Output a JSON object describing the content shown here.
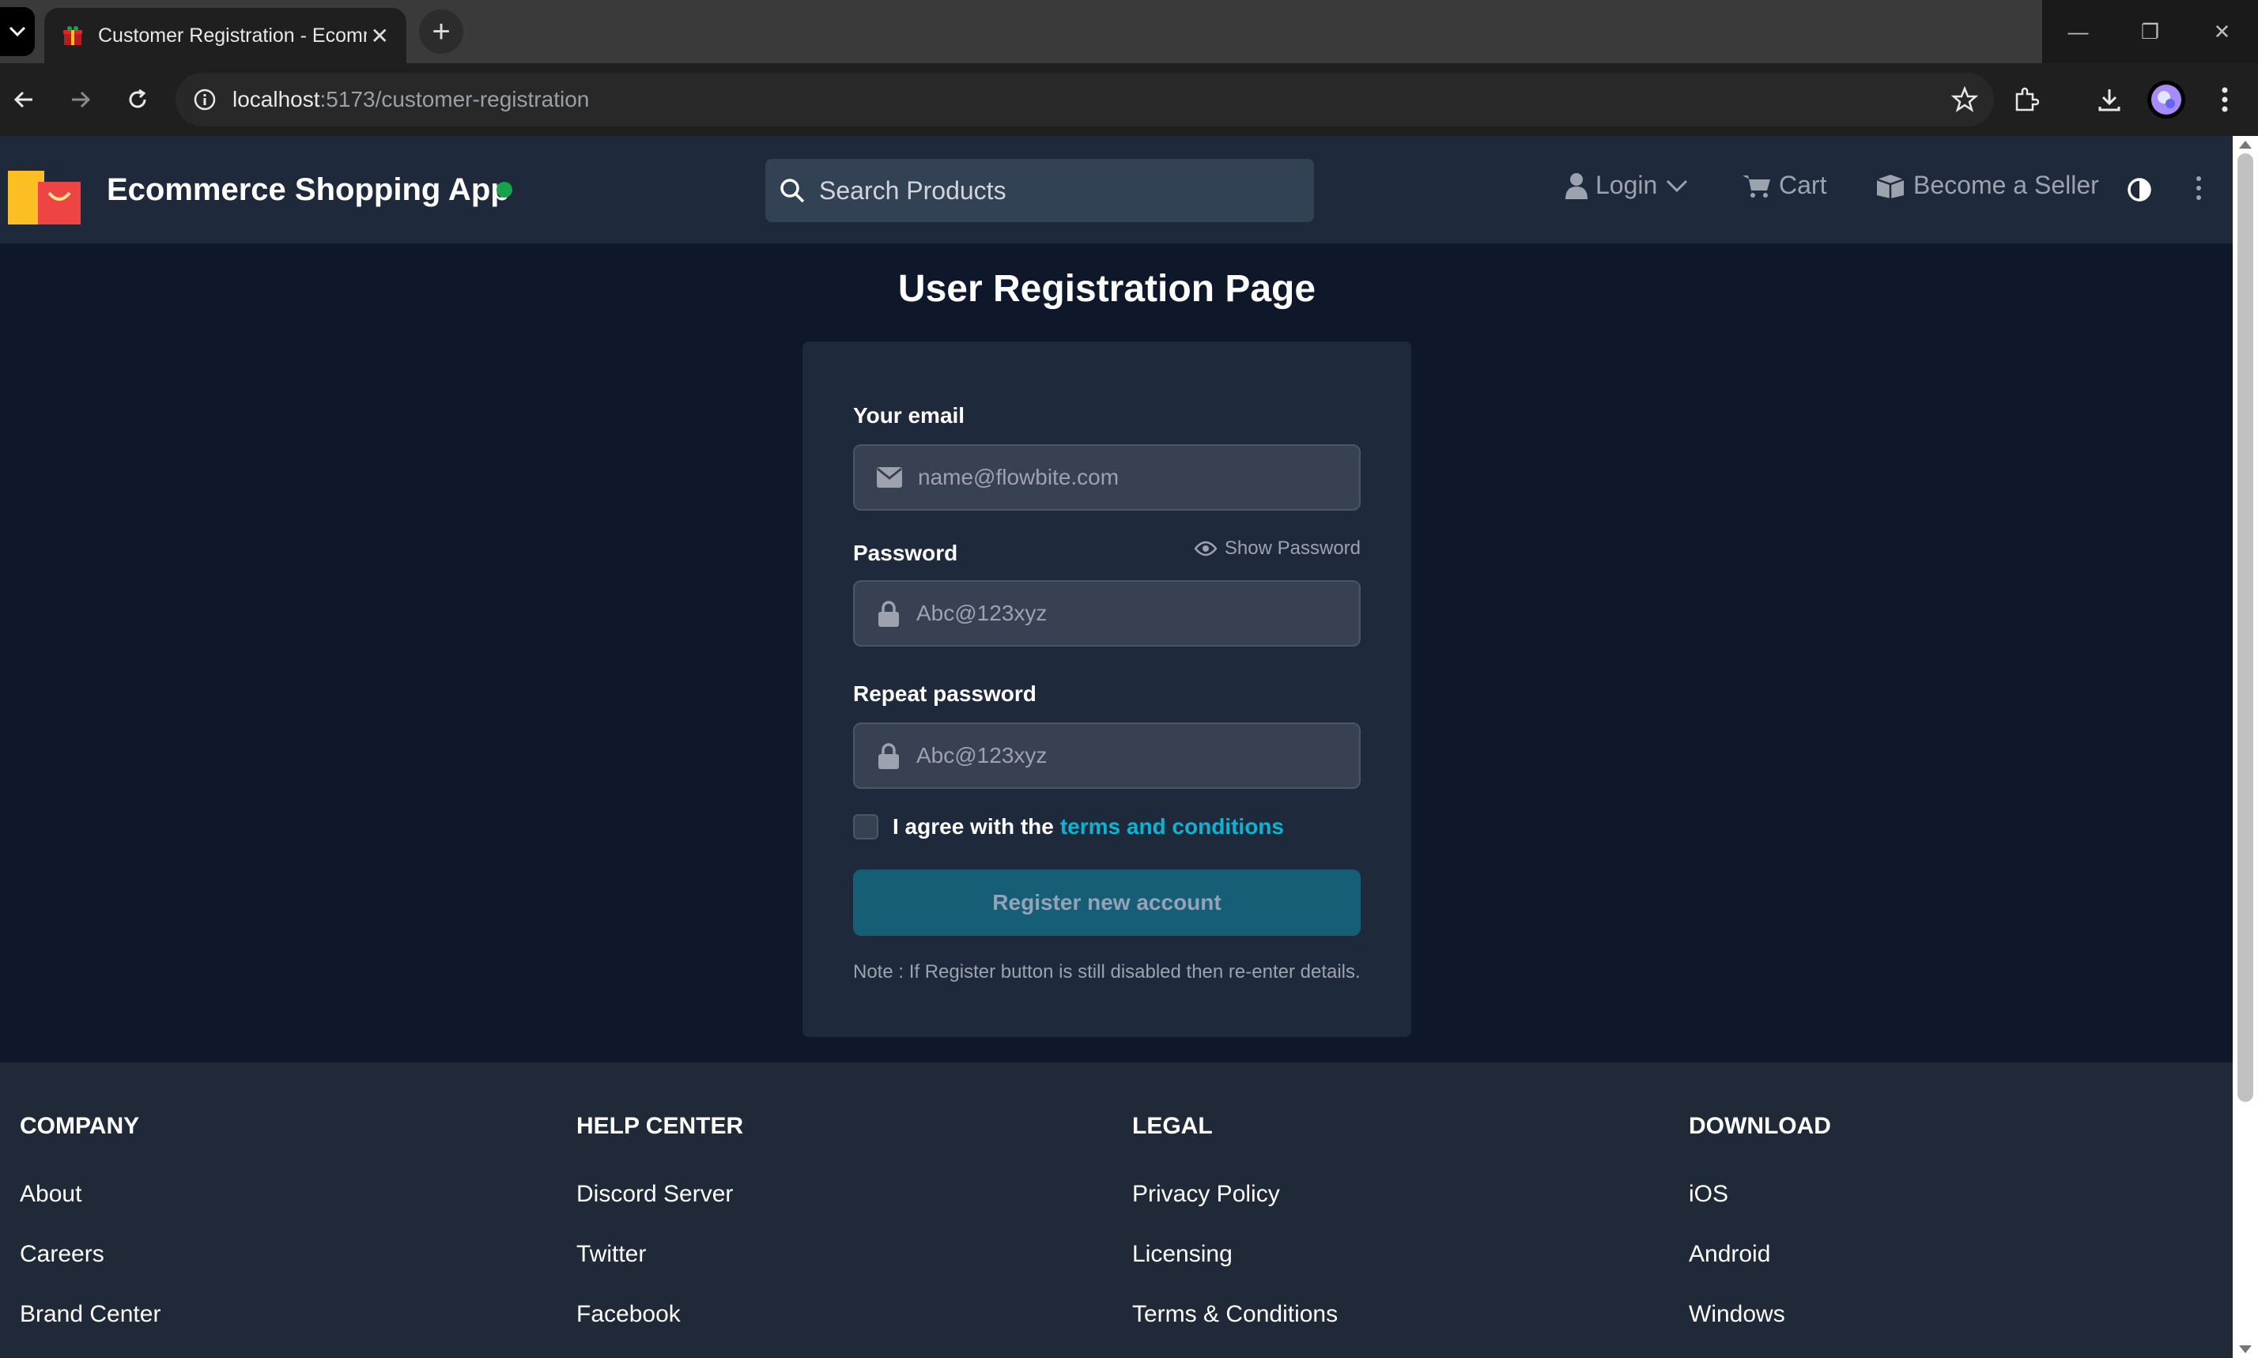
{
  "browser": {
    "tab_title": "Customer Registration - Ecomm",
    "url_host": "localhost",
    "url_path": ":5173/customer-registration"
  },
  "navbar": {
    "brand": "Ecommerce Shopping App",
    "search_placeholder": "Search Products",
    "login": "Login",
    "cart": "Cart",
    "seller": "Become a Seller"
  },
  "form": {
    "heading": "User Registration Page",
    "email_label": "Your email",
    "email_placeholder": "name@flowbite.com",
    "password_label": "Password",
    "show_password": "Show Password",
    "password_placeholder": "Abc@123xyz",
    "repeat_label": "Repeat password",
    "repeat_placeholder": "Abc@123xyz",
    "agree_text": "I agree with the",
    "terms_link": "terms and conditions",
    "register_button": "Register new account",
    "note": "Note : If Register button is still disabled then re-enter details."
  },
  "footer": {
    "columns": [
      {
        "heading": "COMPANY",
        "items": [
          "About",
          "Careers",
          "Brand Center"
        ]
      },
      {
        "heading": "HELP CENTER",
        "items": [
          "Discord Server",
          "Twitter",
          "Facebook"
        ]
      },
      {
        "heading": "LEGAL",
        "items": [
          "Privacy Policy",
          "Licensing",
          "Terms & Conditions"
        ]
      },
      {
        "heading": "DOWNLOAD",
        "items": [
          "iOS",
          "Android",
          "Windows"
        ]
      }
    ]
  }
}
